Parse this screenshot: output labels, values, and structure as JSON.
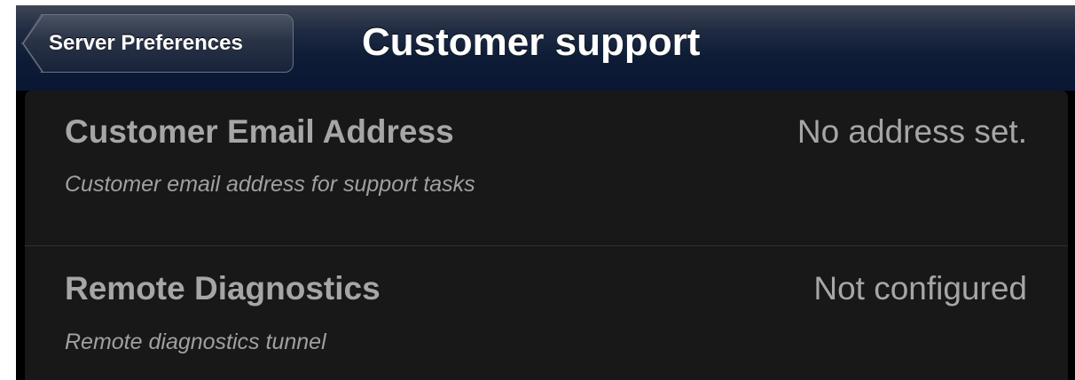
{
  "navbar": {
    "back_label": "Server Preferences",
    "title": "Customer support"
  },
  "rows": [
    {
      "title": "Customer Email Address",
      "subtitle": "Customer email address for support tasks",
      "value": "No address set."
    },
    {
      "title": "Remote Diagnostics",
      "subtitle": "Remote diagnostics tunnel",
      "value": "Not configured"
    }
  ],
  "colors": {
    "navbar": "#0e1c36",
    "list_background": "#181818",
    "text_primary": "#a6a6a6",
    "divider": "#303030"
  }
}
